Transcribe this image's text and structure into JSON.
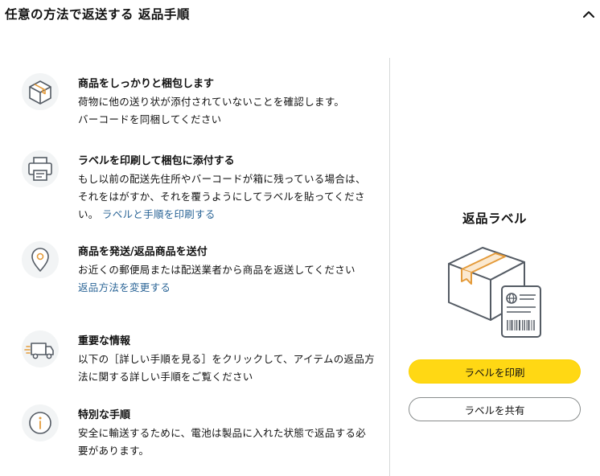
{
  "header": {
    "title": "任意の方法で返送する 返品手順",
    "collapse_icon": "chevron-up-icon"
  },
  "steps": [
    {
      "icon": "package-icon",
      "title": "商品をしっかりと梱包します",
      "desc_lines": [
        "荷物に他の送り状が添付されていないことを確認します。",
        "バーコードを同梱してください"
      ]
    },
    {
      "icon": "printer-icon",
      "title": "ラベルを印刷して梱包に添付する",
      "desc": "もし以前の配送先住所やバーコードが箱に残っている場合は、それをはがすか、それを覆うようにしてラベルを貼ってください。",
      "link": "ラベルと手順を印刷する"
    },
    {
      "icon": "location-pin-icon",
      "title": "商品を発送/返品商品を送付",
      "desc": "お近くの郵便局または配送業者から商品を返送してください",
      "link": "返品方法を変更する"
    },
    {
      "icon": "delivery-truck-icon",
      "title": "重要な情報",
      "desc": "以下の［詳しい手順を見る］をクリックして、アイテムの返品方法に関する詳しい手順をご覧ください"
    },
    {
      "icon": "info-icon",
      "title": "特別な手順",
      "desc": "安全に輸送するために、電池は製品に入れた状態で返品する必要があります。"
    }
  ],
  "label_panel": {
    "title": "返品ラベル",
    "illustration_icon": "package-label-icon",
    "print_button": "ラベルを印刷",
    "share_button": "ラベルを共有"
  },
  "colors": {
    "accent_yellow": "#ffd814",
    "link_blue": "#2a6496",
    "icon_orange": "#e49b3b",
    "icon_gray": "#545b64"
  }
}
